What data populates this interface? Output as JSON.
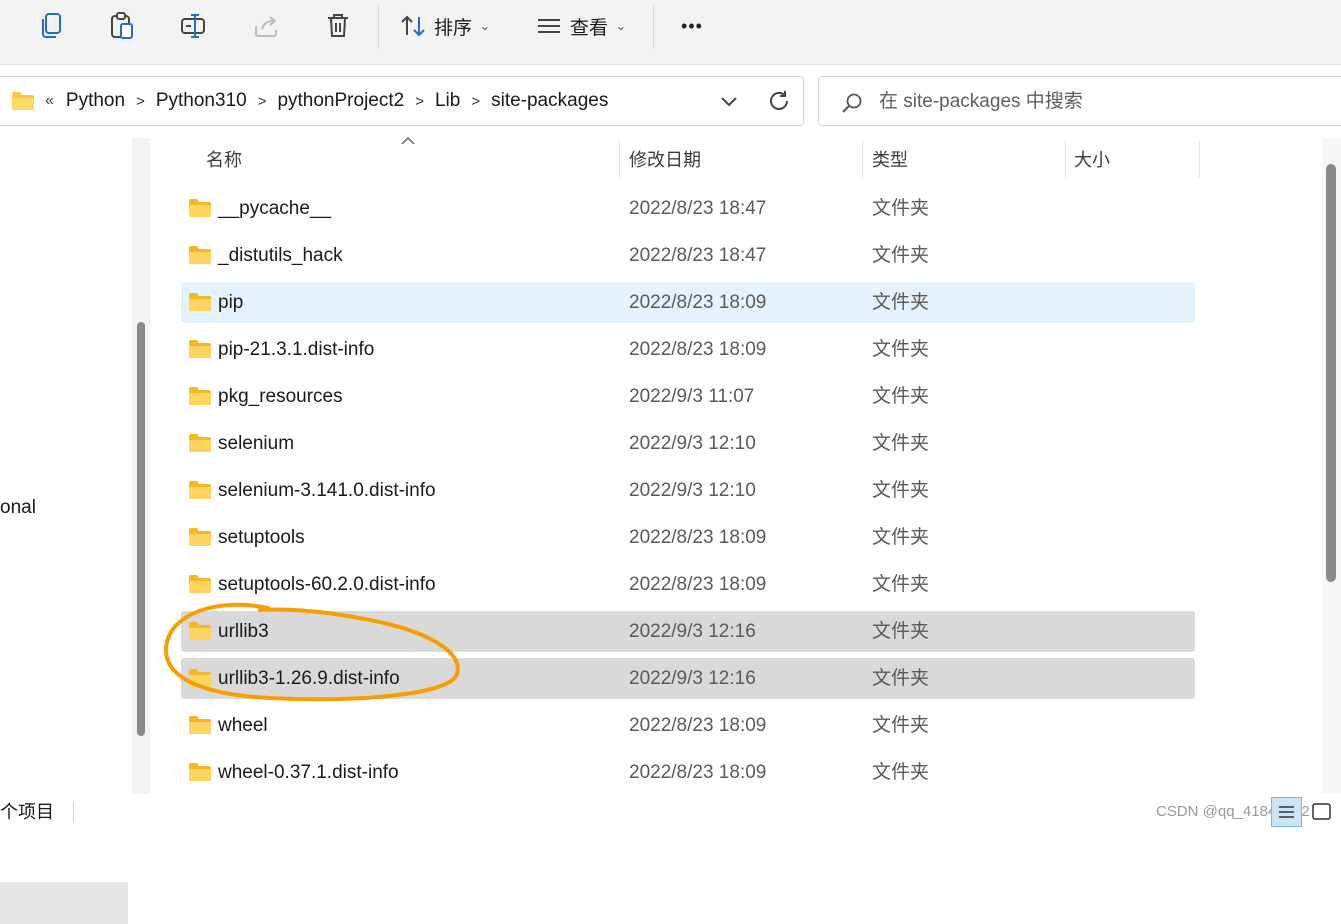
{
  "toolbar": {
    "sort_label": "排序",
    "view_label": "查看",
    "more_label": "•••"
  },
  "address": {
    "overflow": "«",
    "breadcrumbs": [
      "Python",
      "Python310",
      "pythonProject2",
      "Lib",
      "site-packages"
    ]
  },
  "search": {
    "placeholder": "在 site-packages 中搜索"
  },
  "nav": {
    "partial_item": "onal"
  },
  "columns": {
    "name": "名称",
    "modified": "修改日期",
    "type": "类型",
    "size": "大小"
  },
  "rows": [
    {
      "name": "__pycache__",
      "date": "2022/8/23 18:47",
      "type": "文件夹",
      "state": "normal"
    },
    {
      "name": "_distutils_hack",
      "date": "2022/8/23 18:47",
      "type": "文件夹",
      "state": "normal"
    },
    {
      "name": "pip",
      "date": "2022/8/23 18:09",
      "type": "文件夹",
      "state": "hover"
    },
    {
      "name": "pip-21.3.1.dist-info",
      "date": "2022/8/23 18:09",
      "type": "文件夹",
      "state": "normal"
    },
    {
      "name": "pkg_resources",
      "date": "2022/9/3 11:07",
      "type": "文件夹",
      "state": "normal"
    },
    {
      "name": "selenium",
      "date": "2022/9/3 12:10",
      "type": "文件夹",
      "state": "normal"
    },
    {
      "name": "selenium-3.141.0.dist-info",
      "date": "2022/9/3 12:10",
      "type": "文件夹",
      "state": "normal"
    },
    {
      "name": "setuptools",
      "date": "2022/8/23 18:09",
      "type": "文件夹",
      "state": "normal"
    },
    {
      "name": "setuptools-60.2.0.dist-info",
      "date": "2022/8/23 18:09",
      "type": "文件夹",
      "state": "normal"
    },
    {
      "name": "urllib3",
      "date": "2022/9/3 12:16",
      "type": "文件夹",
      "state": "selected"
    },
    {
      "name": "urllib3-1.26.9.dist-info",
      "date": "2022/9/3 12:16",
      "type": "文件夹",
      "state": "selected"
    },
    {
      "name": "wheel",
      "date": "2022/8/23 18:09",
      "type": "文件夹",
      "state": "normal"
    },
    {
      "name": "wheel-0.37.1.dist-info",
      "date": "2022/8/23 18:09",
      "type": "文件夹",
      "state": "normal"
    }
  ],
  "status": {
    "count_text": "个项目"
  },
  "watermark": "CSDN @qq_41845402",
  "colors": {
    "folder": "#f7c948",
    "hover_row": "#e5f3ff",
    "selected_row": "#d9d9d9",
    "annotation": "#f5a000",
    "accent": "#0067c0"
  }
}
